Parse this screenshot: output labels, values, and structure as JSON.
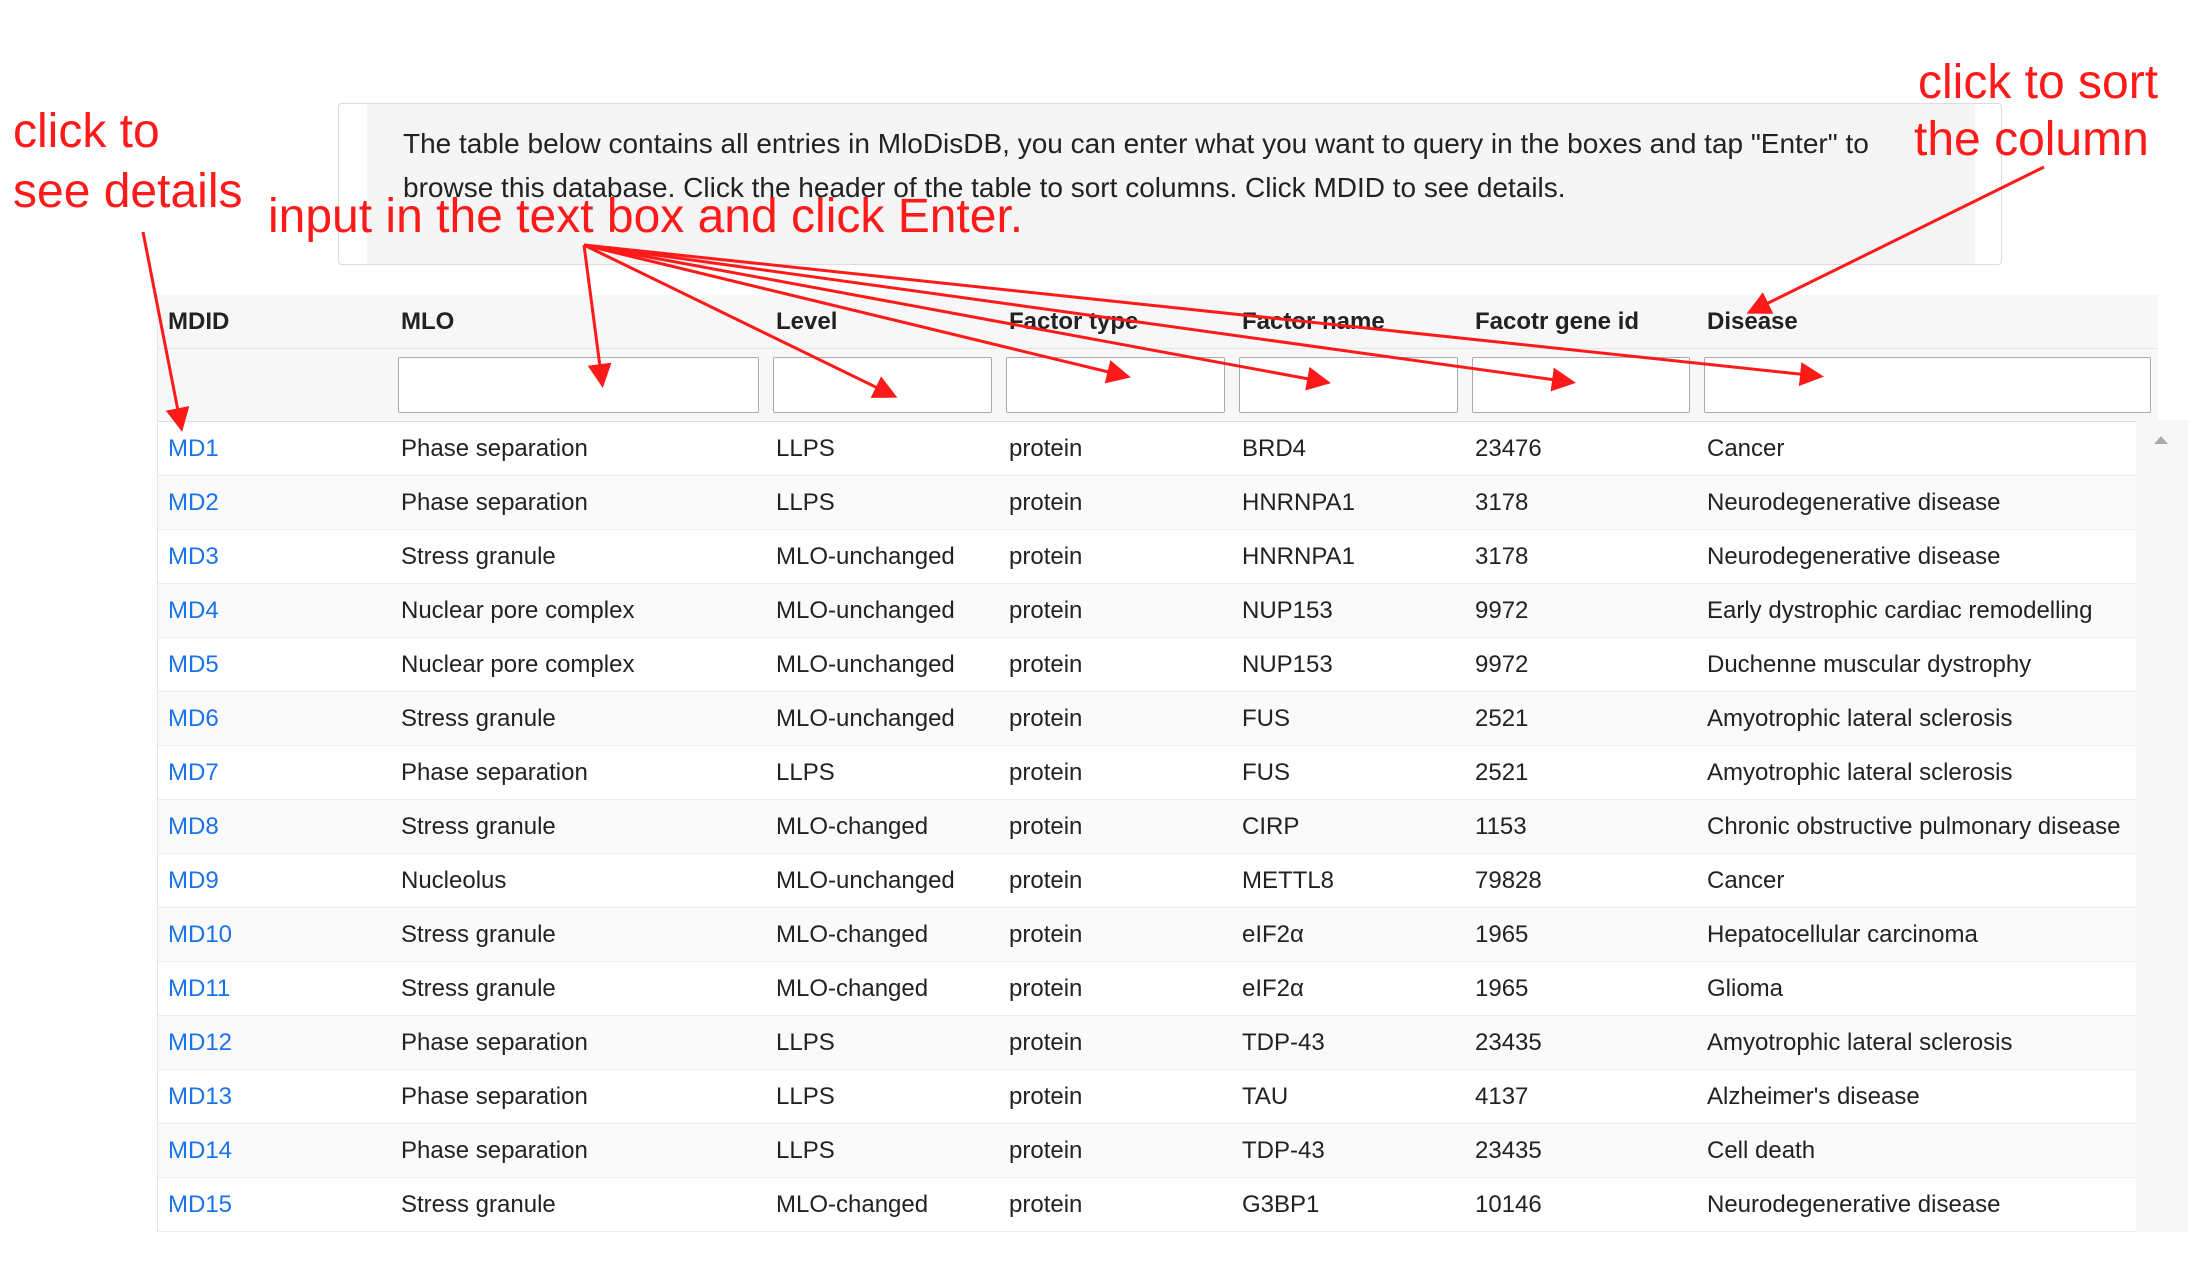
{
  "notice": {
    "text": "The table below contains all entries in MloDisDB, you can enter what you want to query in the boxes and tap \"Enter\" to browse this database. Click the header of the table to sort columns. Click MDID to see details."
  },
  "annotations": {
    "details": [
      "click to",
      "see details"
    ],
    "input": "input in the text box and click Enter.",
    "sort": [
      "click to sort",
      "the column"
    ],
    "color": "#ff1a1a"
  },
  "table": {
    "headers": [
      "MDID",
      "MLO",
      "Level",
      "Factor type",
      "Factor name",
      "Facotr gene id",
      "Disease"
    ],
    "filters": [
      {
        "column": "MDID",
        "has_input": false,
        "value": ""
      },
      {
        "column": "MLO",
        "has_input": true,
        "value": ""
      },
      {
        "column": "Level",
        "has_input": true,
        "value": ""
      },
      {
        "column": "Factor type",
        "has_input": true,
        "value": ""
      },
      {
        "column": "Factor name",
        "has_input": true,
        "value": ""
      },
      {
        "column": "Facotr gene id",
        "has_input": true,
        "value": ""
      },
      {
        "column": "Disease",
        "has_input": true,
        "value": ""
      }
    ],
    "rows": [
      [
        "MD1",
        "Phase separation",
        "LLPS",
        "protein",
        "BRD4",
        "23476",
        "Cancer"
      ],
      [
        "MD2",
        "Phase separation",
        "LLPS",
        "protein",
        "HNRNPA1",
        "3178",
        "Neurodegenerative disease"
      ],
      [
        "MD3",
        "Stress granule",
        "MLO-unchanged",
        "protein",
        "HNRNPA1",
        "3178",
        "Neurodegenerative disease"
      ],
      [
        "MD4",
        "Nuclear pore complex",
        "MLO-unchanged",
        "protein",
        "NUP153",
        "9972",
        "Early dystrophic cardiac remodelling"
      ],
      [
        "MD5",
        "Nuclear pore complex",
        "MLO-unchanged",
        "protein",
        "NUP153",
        "9972",
        "Duchenne muscular dystrophy"
      ],
      [
        "MD6",
        "Stress granule",
        "MLO-unchanged",
        "protein",
        "FUS",
        "2521",
        "Amyotrophic lateral sclerosis"
      ],
      [
        "MD7",
        "Phase separation",
        "LLPS",
        "protein",
        "FUS",
        "2521",
        "Amyotrophic lateral sclerosis"
      ],
      [
        "MD8",
        "Stress granule",
        "MLO-changed",
        "protein",
        "CIRP",
        "1153",
        "Chronic obstructive pulmonary disease"
      ],
      [
        "MD9",
        "Nucleolus",
        "MLO-unchanged",
        "protein",
        "METTL8",
        "79828",
        "Cancer"
      ],
      [
        "MD10",
        "Stress granule",
        "MLO-changed",
        "protein",
        "eIF2α",
        "1965",
        "Hepatocellular carcinoma"
      ],
      [
        "MD11",
        "Stress granule",
        "MLO-changed",
        "protein",
        "eIF2α",
        "1965",
        "Glioma"
      ],
      [
        "MD12",
        "Phase separation",
        "LLPS",
        "protein",
        "TDP-43",
        "23435",
        "Amyotrophic lateral sclerosis"
      ],
      [
        "MD13",
        "Phase separation",
        "LLPS",
        "protein",
        "TAU",
        "4137",
        "Alzheimer's disease"
      ],
      [
        "MD14",
        "Phase separation",
        "LLPS",
        "protein",
        "TDP-43",
        "23435",
        "Cell death"
      ],
      [
        "MD15",
        "Stress granule",
        "MLO-changed",
        "protein",
        "G3BP1",
        "10146",
        "Neurodegenerative disease"
      ]
    ]
  },
  "colors": {
    "link": "#1a73e8",
    "annotation": "#ff1a1a"
  }
}
